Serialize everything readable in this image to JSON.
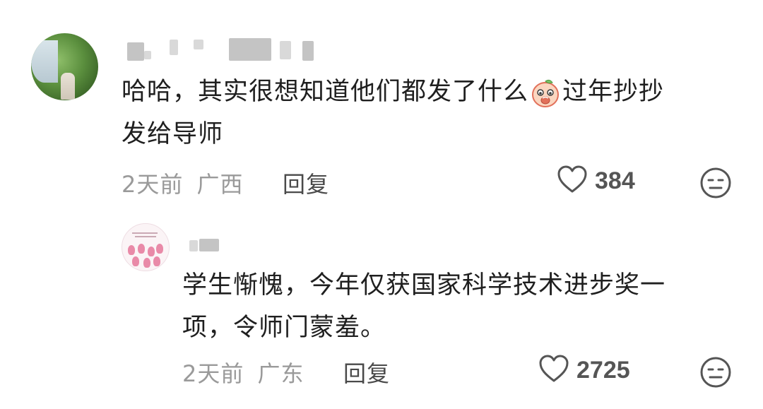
{
  "comments": [
    {
      "text_line1_a": "哈哈，其实很想知道他们都发了什么",
      "emoji": "peach-face-emoji",
      "text_line1_b": "过年抄抄",
      "text_line2": "发给导师",
      "time": "2天前",
      "location": "广西",
      "reply_label": "回复",
      "like_count": "384"
    },
    {
      "text_line1": "学生惭愧，今年仅获国家科学技术进步奖一",
      "text_line2": "项，令师门蒙羞。",
      "time": "2天前",
      "location": "广东",
      "reply_label": "回复",
      "like_count": "2725"
    }
  ],
  "icons": {
    "like": "heart-outline-icon",
    "dislike": "neutral-face-icon"
  },
  "colors": {
    "text": "#1f1f1f",
    "meta": "#9a9a9a",
    "reply": "#4a4a4a",
    "icon": "#555555"
  }
}
